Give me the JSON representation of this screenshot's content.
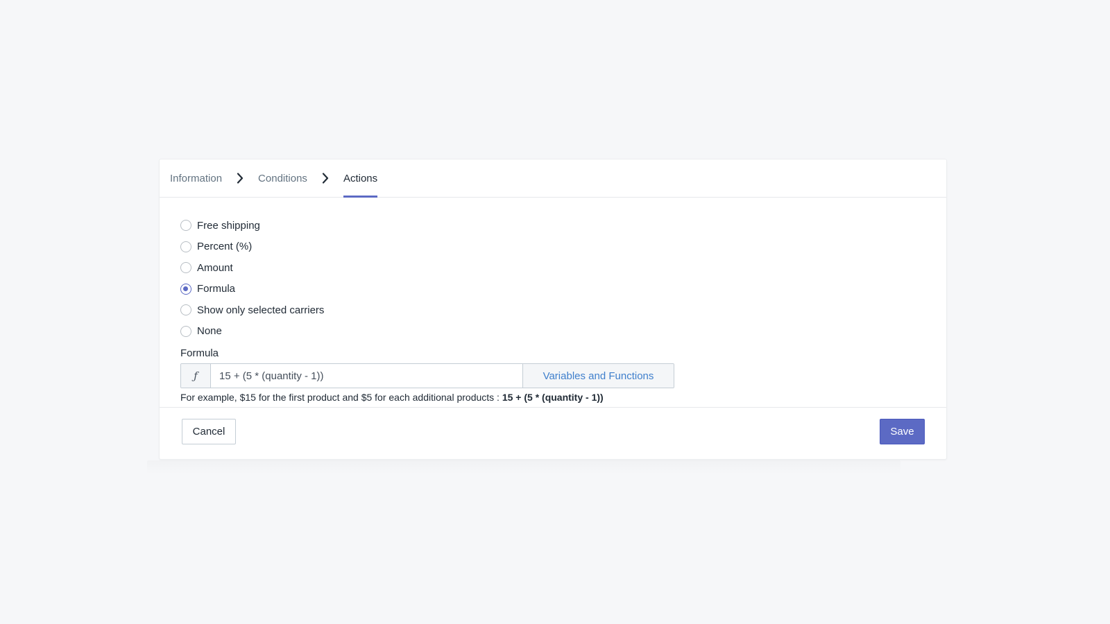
{
  "steps": {
    "items": [
      {
        "label": "Information",
        "active": false
      },
      {
        "label": "Conditions",
        "active": false
      },
      {
        "label": "Actions",
        "active": true
      }
    ]
  },
  "actions": {
    "options": [
      {
        "label": "Free shipping",
        "checked": false
      },
      {
        "label": "Percent (%)",
        "checked": false
      },
      {
        "label": "Amount",
        "checked": false
      },
      {
        "label": "Formula",
        "checked": true
      },
      {
        "label": "Show only selected carriers",
        "checked": false
      },
      {
        "label": "None",
        "checked": false
      }
    ]
  },
  "formula": {
    "label": "Formula",
    "addon_symbol": "ƒ",
    "value": "15 + (5 * (quantity - 1))",
    "vars_button": "Variables and Functions",
    "help_prefix": "For example, $15 for the first product and $5 for each additional products : ",
    "help_example": "15 + (5 * (quantity - 1))"
  },
  "footer": {
    "cancel_label": "Cancel",
    "save_label": "Save"
  },
  "colors": {
    "accent": "#5c6ac4",
    "link": "#3f7fcc",
    "background": "#f6f7f9"
  }
}
